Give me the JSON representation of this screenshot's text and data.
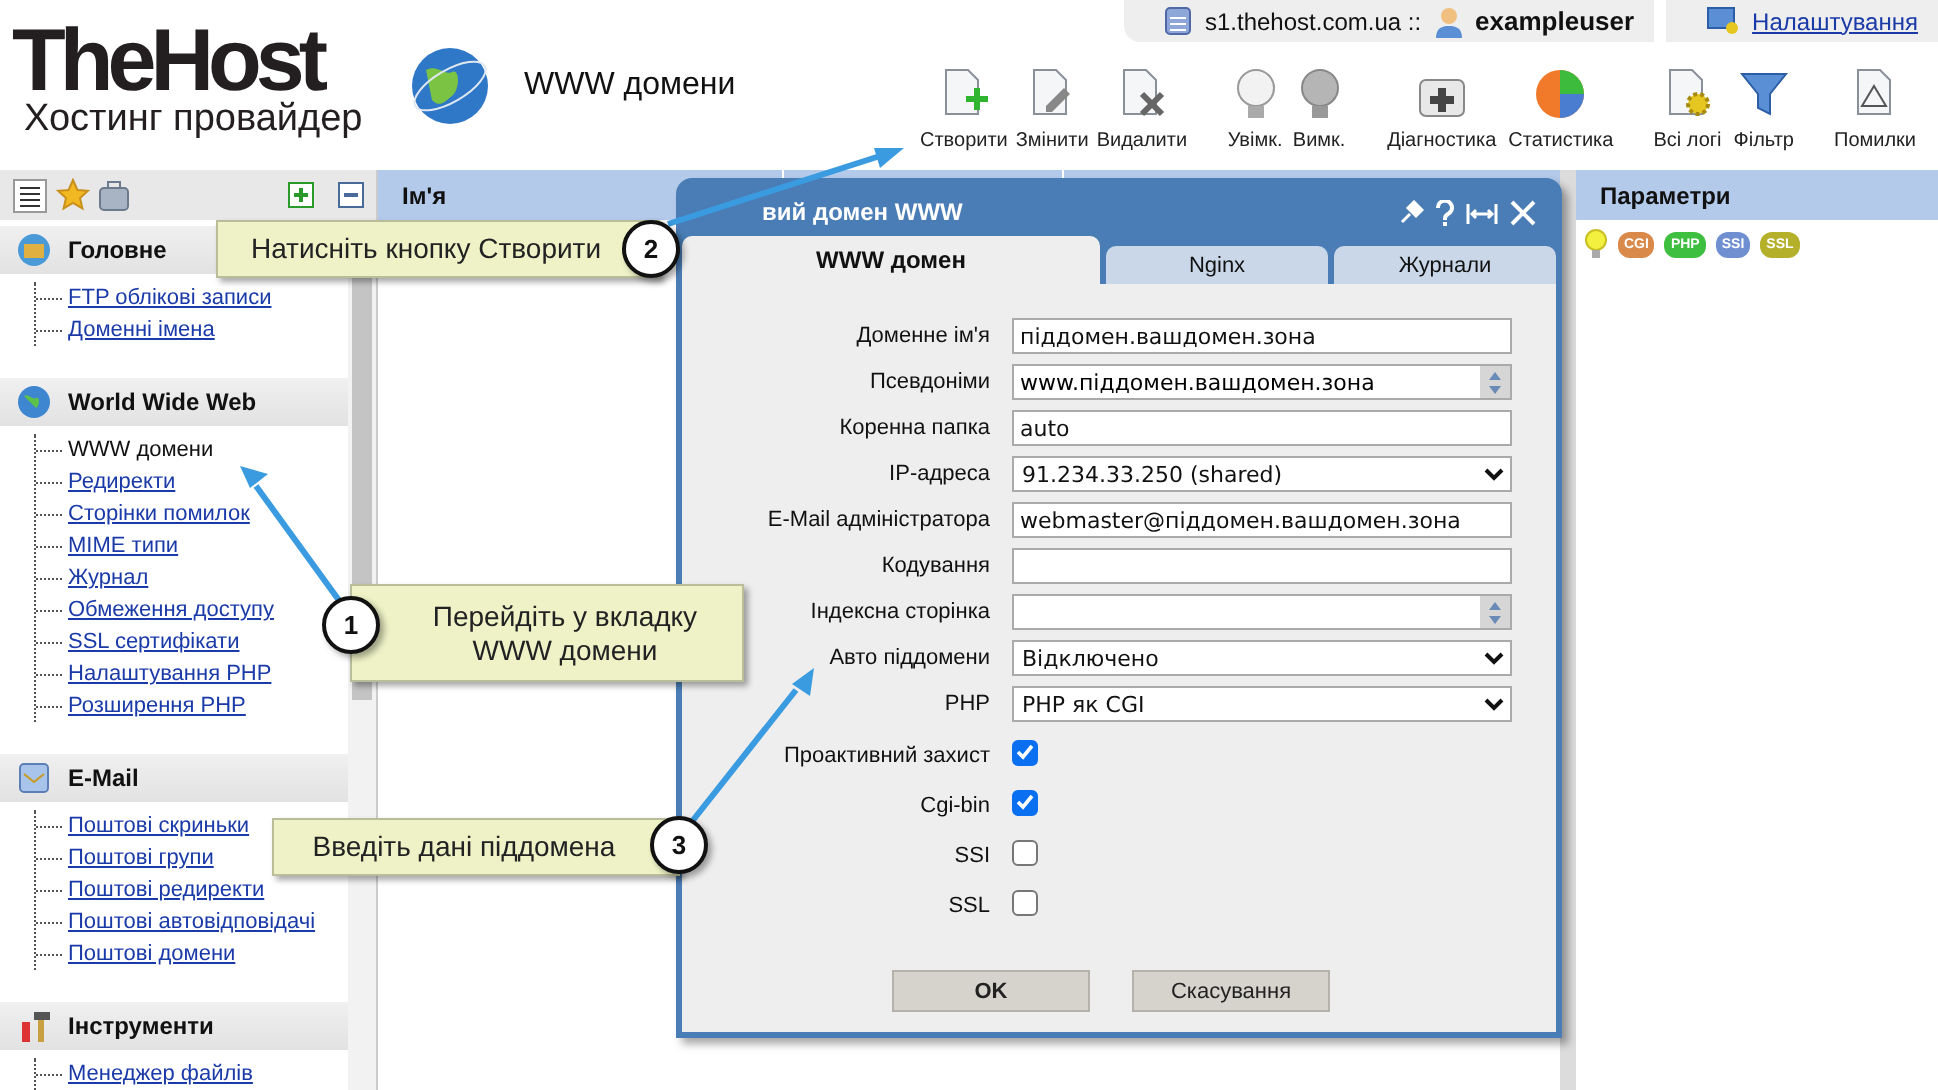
{
  "logo": {
    "name": "TheHost",
    "tagline": "Хостинг провайдер"
  },
  "page_title": "WWW домени",
  "top_bar": {
    "server": "s1.thehost.com.ua ::",
    "user": "exampleuser",
    "settings_link": "Налаштування"
  },
  "toolbar": [
    {
      "kind": "create",
      "label": "Створити"
    },
    {
      "kind": "edit",
      "label": "Змінити"
    },
    {
      "kind": "delete",
      "label": "Видалити"
    },
    {
      "kind": "on",
      "label": "Увімк."
    },
    {
      "kind": "off",
      "label": "Вимк."
    },
    {
      "kind": "diagnostics",
      "label": "Діагностика"
    },
    {
      "kind": "stats",
      "label": "Статистика"
    },
    {
      "kind": "logs",
      "label": "Всі логі"
    },
    {
      "kind": "filter",
      "label": "Фільтр"
    },
    {
      "kind": "errors",
      "label": "Помилки"
    }
  ],
  "sidebar": {
    "sections": [
      {
        "kind": "main",
        "title": "Головне",
        "items": [
          {
            "label": "FTP облікові записи",
            "selected": false
          },
          {
            "label": "Доменні імена",
            "selected": false
          }
        ]
      },
      {
        "kind": "web",
        "title": "World Wide Web",
        "items": [
          {
            "label": "WWW домени",
            "selected": true
          },
          {
            "label": "Редиректи",
            "selected": false
          },
          {
            "label": "Сторінки помилок",
            "selected": false
          },
          {
            "label": "MIME типи",
            "selected": false
          },
          {
            "label": "Журнал",
            "selected": false
          },
          {
            "label": "Обмеження доступу",
            "selected": false
          },
          {
            "label": "SSL сертифікати",
            "selected": false
          },
          {
            "label": "Налаштування PHP",
            "selected": false
          },
          {
            "label": "Розширення PHP",
            "selected": false
          }
        ]
      },
      {
        "kind": "mail",
        "title": "E-Mail",
        "items": [
          {
            "label": "Поштові скриньки",
            "selected": false
          },
          {
            "label": "Поштові групи",
            "selected": false
          },
          {
            "label": "Поштові редиректи",
            "selected": false
          },
          {
            "label": "Поштові автовідповідачі",
            "selected": false
          },
          {
            "label": "Поштові домени",
            "selected": false
          }
        ]
      },
      {
        "kind": "tools",
        "title": "Інструменти",
        "items": [
          {
            "label": "Менеджер файлів",
            "selected": false
          }
        ]
      }
    ]
  },
  "table": {
    "columns": [
      {
        "label": "Ім'я"
      }
    ]
  },
  "right_panel": {
    "title": "Параметри",
    "badges": [
      {
        "label": "CGI",
        "color": "#d98a4a"
      },
      {
        "label": "PHP",
        "color": "#3fbf3f"
      },
      {
        "label": "SSI",
        "color": "#6f8fd0"
      },
      {
        "label": "SSL",
        "color": "#b5b02a"
      }
    ]
  },
  "dialog": {
    "title": "вий домен WWW",
    "tabs": [
      {
        "label": "WWW домен",
        "selected": true
      },
      {
        "label": "Nginx",
        "selected": false
      },
      {
        "label": "Журнали",
        "selected": false
      }
    ],
    "fields": [
      {
        "kind": "text",
        "label": "Доменне ім'я",
        "value": "піддомен.вашдомен.зона"
      },
      {
        "kind": "spinner",
        "label": "Псевдоніми",
        "value": "www.піддомен.вашдомен.зона"
      },
      {
        "kind": "text",
        "label": "Коренна папка",
        "value": "auto"
      },
      {
        "kind": "select",
        "label": "IP-адреса",
        "value": "91.234.33.250 (shared)"
      },
      {
        "kind": "text",
        "label": "E-Mail адміністратора",
        "value": "webmaster@піддомен.вашдомен.зона"
      },
      {
        "kind": "text",
        "label": "Кодування"
      },
      {
        "kind": "spinner",
        "label": "Індексна сторінка"
      },
      {
        "kind": "select",
        "label": "Авто піддомени",
        "value": "Відключено"
      },
      {
        "kind": "select",
        "label": "PHP",
        "value": "PHP як CGI"
      },
      {
        "kind": "checkbox",
        "label": "Проактивний захист",
        "checked": true
      },
      {
        "kind": "checkbox",
        "label": "Cgi-bin",
        "checked": true
      },
      {
        "kind": "checkbox",
        "label": "SSI",
        "checked": false
      },
      {
        "kind": "checkbox",
        "label": "SSL",
        "checked": false
      }
    ],
    "buttons": [
      {
        "kind": "primary",
        "label": "OK"
      },
      {
        "kind": "secondary",
        "label": "Скасування"
      }
    ]
  },
  "callouts": [
    {
      "kind": "toolbar",
      "number": "2",
      "text": "Натисніть кнопку Створити"
    },
    {
      "kind": "sidebar",
      "number": "1",
      "text": "Перейдіть у вкладку WWW домени"
    },
    {
      "kind": "form",
      "number": "3",
      "text": "Введіть дані піддомена"
    }
  ]
}
